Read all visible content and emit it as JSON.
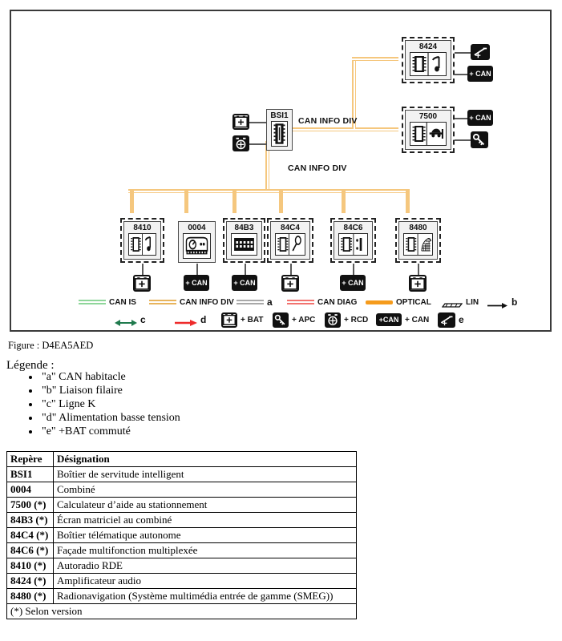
{
  "figure": {
    "caption": "Figure : D4EA5AED",
    "frame_color": "#3a3a3a"
  },
  "diagram": {
    "bus_color": "#f5c77e",
    "wire_label_main": "CAN INFO DIV",
    "wire_label_lower": "CAN INFO DIV",
    "central": {
      "code": "BSI1",
      "left_badges": [
        {
          "name": "+BAT",
          "type": "battery"
        },
        {
          "name": "+RCD",
          "type": "rcd"
        }
      ]
    },
    "right_nodes": [
      {
        "code": "8424",
        "dashed": true,
        "glyph": "amplifier",
        "badges": [
          {
            "label": "",
            "type": "switched-bat",
            "style": "black"
          },
          {
            "label": "+ CAN",
            "type": "can",
            "style": "black"
          }
        ]
      },
      {
        "code": "7500",
        "dashed": true,
        "glyph": "parking-aid",
        "badges": [
          {
            "label": "+ CAN",
            "type": "can",
            "style": "black"
          },
          {
            "label": "",
            "type": "apc",
            "style": "black"
          }
        ]
      }
    ],
    "bottom_nodes": [
      {
        "code": "8410",
        "dashed": true,
        "glyph": "radio",
        "badge": {
          "label": "",
          "type": "battery",
          "style": "white"
        }
      },
      {
        "code": "0004",
        "dashed": false,
        "glyph": "cluster",
        "badge": {
          "label": "+ CAN",
          "type": "can",
          "style": "black"
        }
      },
      {
        "code": "84B3",
        "dashed": true,
        "glyph": "matrix",
        "badge": {
          "label": "+ CAN",
          "type": "can",
          "style": "black"
        }
      },
      {
        "code": "84C4",
        "dashed": true,
        "glyph": "telematic",
        "badge": {
          "label": "",
          "type": "battery",
          "style": "white"
        }
      },
      {
        "code": "84C6",
        "dashed": true,
        "glyph": "facade",
        "badge": {
          "label": "+ CAN",
          "type": "can",
          "style": "black"
        }
      },
      {
        "code": "8480",
        "dashed": true,
        "glyph": "navi",
        "badge": {
          "label": "",
          "type": "battery",
          "style": "white"
        }
      }
    ]
  },
  "legend": {
    "row1": [
      {
        "label": "CAN IS",
        "swatch": "lines",
        "color": "#8fd69a"
      },
      {
        "label": "CAN INFO DIV",
        "swatch": "lines",
        "color": "#e8b45c"
      },
      {
        "label": "a",
        "swatch": "lines",
        "color": "#a8a8a8"
      },
      {
        "label": "CAN DIAG",
        "swatch": "lines",
        "color": "#f2736f"
      },
      {
        "label": "OPTICAL",
        "swatch": "solid",
        "color": "#f59b1c"
      },
      {
        "label": "LIN",
        "swatch": "lin",
        "color": "#111111"
      },
      {
        "label": "b",
        "swatch": "arrow",
        "color": "#111111"
      }
    ],
    "row2": [
      {
        "label": "c",
        "swatch": "biarrow",
        "color": "#1f7a4d"
      },
      {
        "label": "d",
        "swatch": "arrow",
        "color": "#ee2b2b"
      },
      {
        "label": "+ BAT",
        "swatch": "icon",
        "icon": "battery"
      },
      {
        "label": "+ APC",
        "swatch": "icon",
        "icon": "apc"
      },
      {
        "label": "+ RCD",
        "swatch": "icon",
        "icon": "rcd"
      },
      {
        "label": "+ CAN",
        "swatch": "icon",
        "icon": "can"
      },
      {
        "label": "e",
        "swatch": "icon",
        "icon": "switched-bat"
      }
    ]
  },
  "legende": {
    "title": "Légende :",
    "items": [
      "\"a\" CAN habitacle",
      "\"b\" Liaison filaire",
      "\"c\" Ligne K",
      "\"d\" Alimentation basse tension",
      "\"e\" +BAT commuté"
    ]
  },
  "table": {
    "headers": [
      "Repère",
      "Désignation"
    ],
    "rows": [
      [
        "BSI1",
        "Boîtier de servitude intelligent"
      ],
      [
        "0004",
        "Combiné"
      ],
      [
        "7500 (*)",
        "Calculateur d’aide au stationnement"
      ],
      [
        "84B3 (*)",
        "Écran matriciel au combiné"
      ],
      [
        "84C4 (*)",
        "Boîtier télématique autonome"
      ],
      [
        "84C6 (*)",
        "Façade multifonction multiplexée"
      ],
      [
        "8410 (*)",
        "Autoradio RDE"
      ],
      [
        "8424 (*)",
        "Amplificateur audio"
      ],
      [
        "8480 (*)",
        "Radionavigation (Système multimédia entrée de gamme (SMEG))"
      ]
    ],
    "footnote": "(*) Selon version"
  }
}
